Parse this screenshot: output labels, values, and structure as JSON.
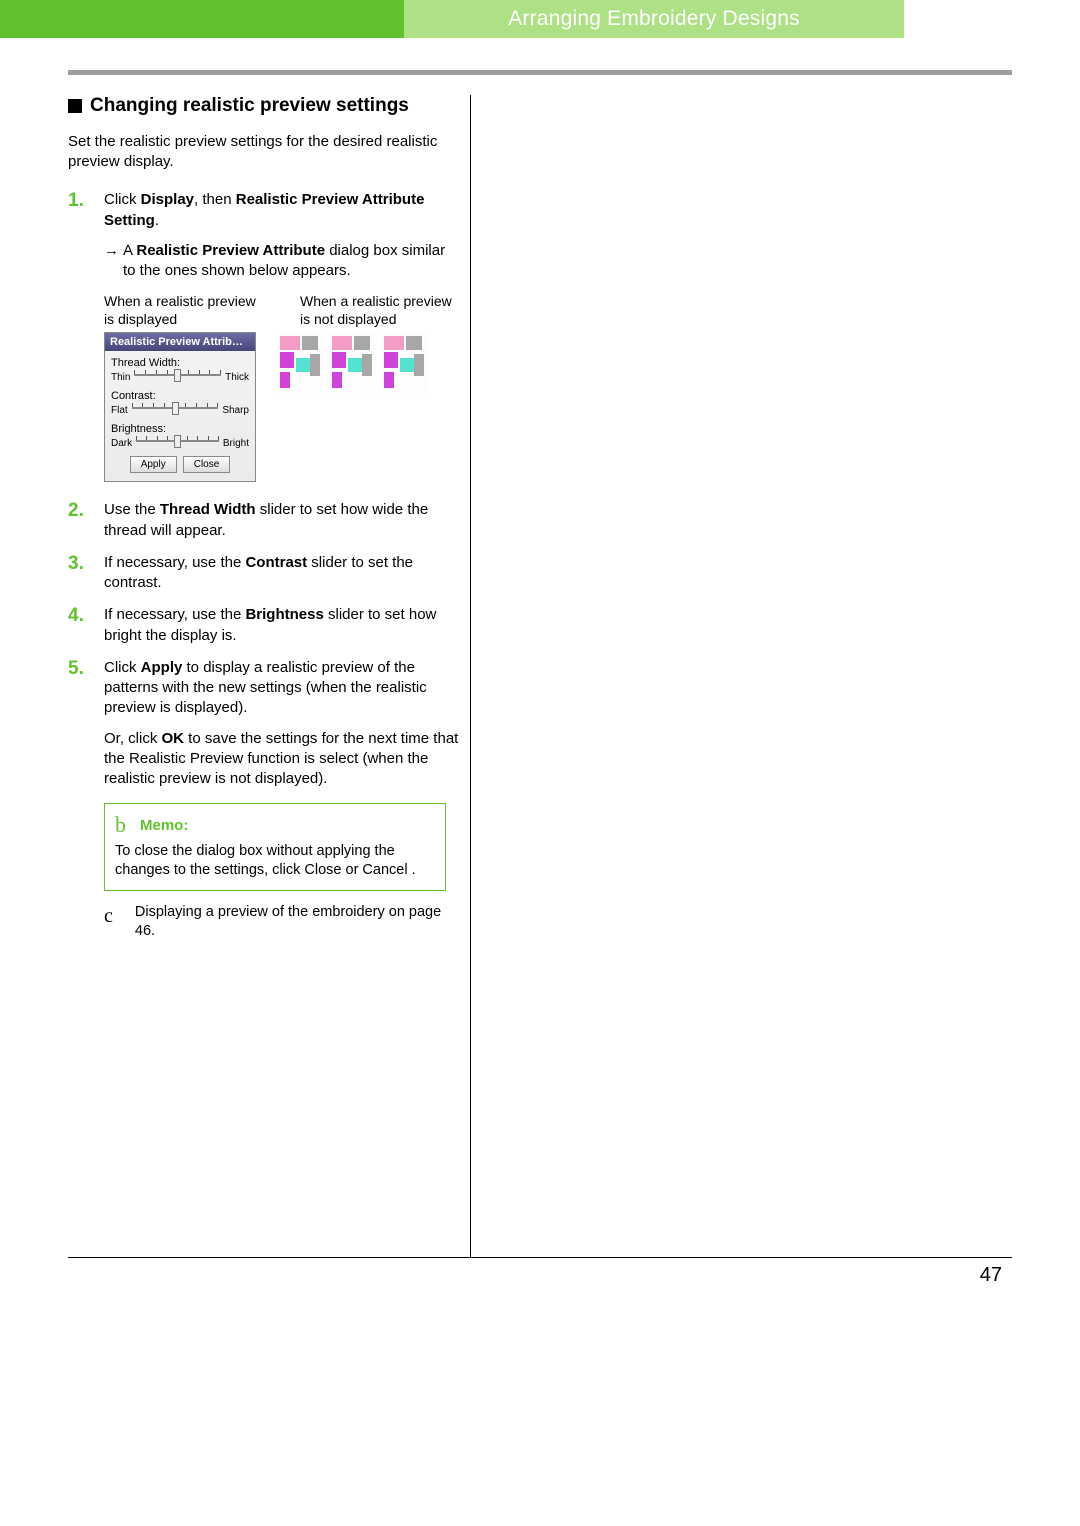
{
  "header": {
    "title": "Arranging Embroidery Designs"
  },
  "section": {
    "title": "Changing realistic preview settings"
  },
  "intro": "Set the realistic preview settings for the desired realistic preview display.",
  "steps": {
    "s1": {
      "num": "1.",
      "t1": "Click ",
      "b1": "Display",
      "t2": ", then ",
      "b2": "Realistic Preview Attribute Setting",
      "t3": ".",
      "sub_arrow": "→",
      "sub_t1": "A ",
      "sub_b1": "Realistic Preview Attribute",
      "sub_t2": " dialog box similar to the ones shown below appears."
    },
    "captions": {
      "left": "When a realistic preview is displayed",
      "right": "When a realistic preview is not displayed"
    },
    "s2": {
      "num": "2.",
      "t1": "Use the ",
      "b1": "Thread Width",
      "t2": " slider to set how wide the thread will appear."
    },
    "s3": {
      "num": "3.",
      "t1": "If necessary, use the ",
      "b1": "Contrast",
      "t2": " slider to set the contrast."
    },
    "s4": {
      "num": "4.",
      "t1": "If necessary, use the ",
      "b1": "Brightness",
      "t2": " slider to set how bright the display is."
    },
    "s5": {
      "num": "5.",
      "t1": "Click ",
      "b1": "Apply",
      "t2": " to display a realistic preview of the patterns with the new settings (when the realistic preview is displayed).",
      "p2a": "Or, click ",
      "p2b": "OK",
      "p2c": " to save the settings for the next time that the Realistic Preview function is select (when the realistic preview is not displayed)."
    }
  },
  "dialog": {
    "title": "Realistic Preview Attrib…",
    "thread_label": "Thread Width:",
    "thin": "Thin",
    "thick": "Thick",
    "contrast_label": "Contrast:",
    "flat": "Flat",
    "sharp": "Sharp",
    "brightness_label": "Brightness:",
    "dark": "Dark",
    "bright": "Bright",
    "apply": "Apply",
    "close": "Close"
  },
  "memo": {
    "b": "b",
    "title": "Memo:",
    "text": "To close the dialog box without applying the changes to the settings, click Close  or Cancel ."
  },
  "xref": {
    "c": "c",
    "text": "Displaying a preview of the embroidery on page 46."
  },
  "page_number": "47"
}
